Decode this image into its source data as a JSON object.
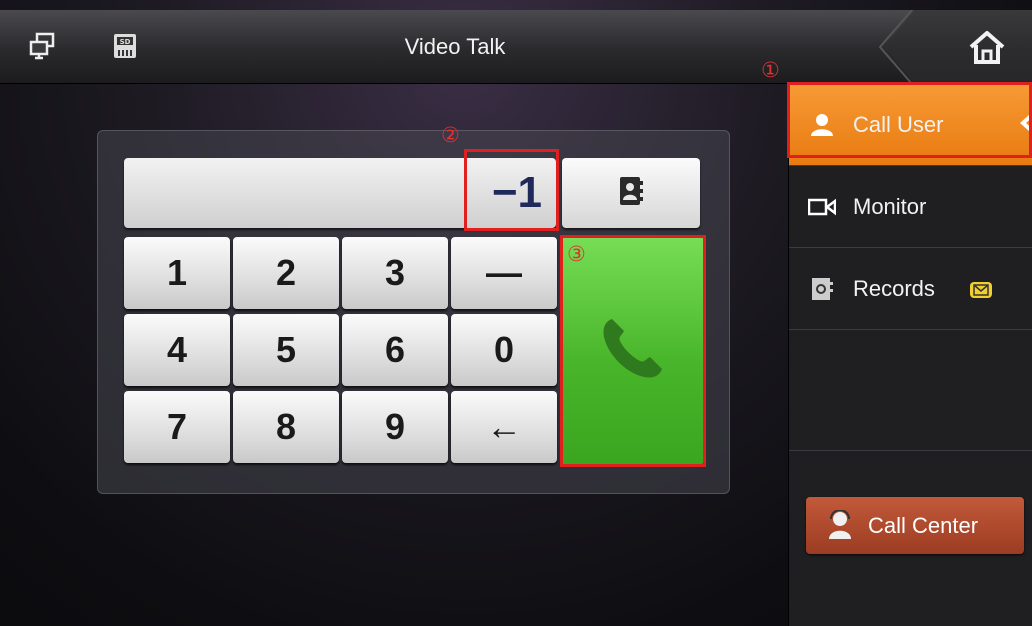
{
  "header": {
    "title": "Video Talk",
    "left_icons": [
      "monitor-icon",
      "sd-card-icon"
    ],
    "home_icon": "home-icon"
  },
  "annotations": [
    "①",
    "②",
    "③"
  ],
  "keypad": {
    "display_value": "−1",
    "keys": [
      "1",
      "2",
      "3",
      "—",
      "4",
      "5",
      "6",
      "0",
      "7",
      "8",
      "9",
      "←"
    ],
    "contacts_icon": "contacts-book-icon",
    "call_icon": "phone-icon"
  },
  "sidebar": {
    "items": [
      {
        "label": "Call User",
        "icon": "user-icon",
        "active": true
      },
      {
        "label": "Monitor",
        "icon": "camera-icon",
        "active": false
      },
      {
        "label": "Records",
        "icon": "records-icon",
        "active": false
      }
    ],
    "call_center": {
      "label": "Call Center",
      "icon": "operator-icon"
    }
  },
  "colors": {
    "accent_orange": "#f08a20",
    "call_green": "#4fbd2f",
    "highlight_red": "#e01f1f",
    "call_center_red": "#b04a2e"
  }
}
